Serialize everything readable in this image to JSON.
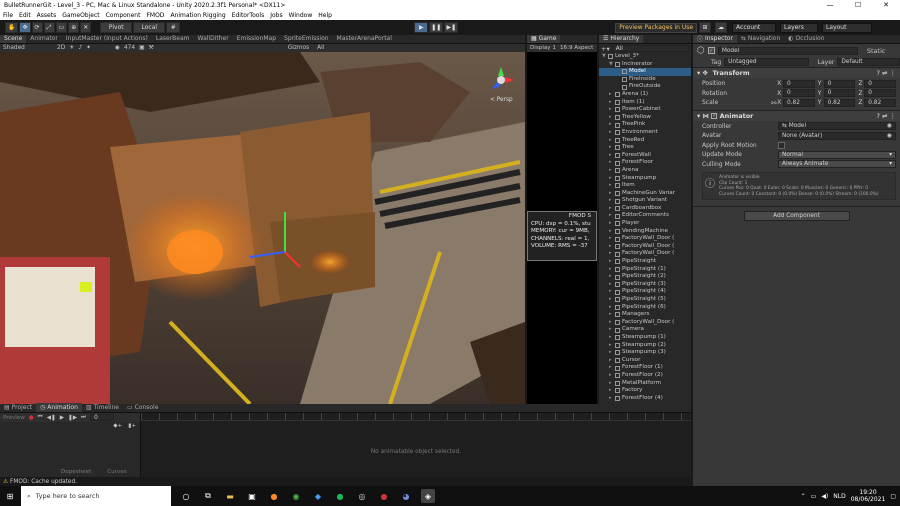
{
  "window": {
    "title": "BulletRunnerGit - Level_3 - PC, Mac & Linux Standalone - Unity 2020.2.3f1 Personal* <DX11>",
    "controls": [
      "—",
      "☐",
      "✕"
    ]
  },
  "menu": [
    "File",
    "Edit",
    "Assets",
    "GameObject",
    "Component",
    "FMOD",
    "Animation Rigging",
    "EditorTools",
    "Jobs",
    "Window",
    "Help"
  ],
  "toolbar": {
    "pivot": "Pivot",
    "local": "Local",
    "preview_packages": "Preview Packages in Use",
    "account": "Account",
    "layers": "Layers",
    "layout": "Layout"
  },
  "scene_tabs": [
    "Scene",
    "Animator",
    "InputMaster (Input Actions)",
    "LaserBeam",
    "WallDither",
    "EmissionMap",
    "SpriteEmission",
    "MasterArenaPortal"
  ],
  "scene_bar": {
    "shading": "Shaded",
    "mode2d": "2D",
    "count": "474",
    "gizmos": "Gizmos",
    "search": "All",
    "persp": "< Persp"
  },
  "game": {
    "tab": "Game",
    "display": "Display 1",
    "aspect": "16:9 Aspect",
    "fmod_title": "FMOD S",
    "fmod_lines": [
      "CPU: dsp = 0.1%, stu",
      "MEMORY: cur = 9MB,",
      "CHANNELS: real = 1,",
      "VOLUME: RMS = -37"
    ]
  },
  "hierarchy": {
    "tab": "Hierarchy",
    "search": "All",
    "items": [
      {
        "name": "Level_3*",
        "indent": 0,
        "arrow": "▼",
        "sel": false
      },
      {
        "name": "Incinerator",
        "indent": 1,
        "arrow": "▼",
        "sel": false
      },
      {
        "name": "Model",
        "indent": 2,
        "arrow": "",
        "sel": true
      },
      {
        "name": "FireInside",
        "indent": 2,
        "arrow": "",
        "sel": false
      },
      {
        "name": "FireOutside",
        "indent": 2,
        "arrow": "",
        "sel": false
      },
      {
        "name": "Arena (1)",
        "indent": 1,
        "arrow": "▸",
        "sel": false
      },
      {
        "name": "Item (1)",
        "indent": 1,
        "arrow": "▸",
        "sel": false
      },
      {
        "name": "PowerCabinet",
        "indent": 1,
        "arrow": "▸",
        "sel": false
      },
      {
        "name": "TreeYellow",
        "indent": 1,
        "arrow": "▸",
        "sel": false
      },
      {
        "name": "TreePink",
        "indent": 1,
        "arrow": "▸",
        "sel": false
      },
      {
        "name": "Environment",
        "indent": 1,
        "arrow": "▸",
        "sel": false
      },
      {
        "name": "TreeRed",
        "indent": 1,
        "arrow": "▸",
        "sel": false
      },
      {
        "name": "Tree",
        "indent": 1,
        "arrow": "▸",
        "sel": false
      },
      {
        "name": "ForestWall",
        "indent": 1,
        "arrow": "▸",
        "sel": false
      },
      {
        "name": "ForestFloor",
        "indent": 1,
        "arrow": "▸",
        "sel": false
      },
      {
        "name": "Arena",
        "indent": 1,
        "arrow": "▸",
        "sel": false
      },
      {
        "name": "Steampump",
        "indent": 1,
        "arrow": "▸",
        "sel": false
      },
      {
        "name": "Item",
        "indent": 1,
        "arrow": "▸",
        "sel": false
      },
      {
        "name": "MachineGun Variar",
        "indent": 1,
        "arrow": "▸",
        "sel": false
      },
      {
        "name": "Shotgun Variant",
        "indent": 1,
        "arrow": "▸",
        "sel": false
      },
      {
        "name": "Cardboardbox",
        "indent": 1,
        "arrow": "▸",
        "sel": false
      },
      {
        "name": "EditorComments",
        "indent": 1,
        "arrow": "▸",
        "sel": false
      },
      {
        "name": "Player",
        "indent": 1,
        "arrow": "▸",
        "sel": false
      },
      {
        "name": "VendingMachine",
        "indent": 1,
        "arrow": "▸",
        "sel": false
      },
      {
        "name": "FactoryWall_Door (",
        "indent": 1,
        "arrow": "▸",
        "sel": false
      },
      {
        "name": "FactoryWall_Door (",
        "indent": 1,
        "arrow": "▸",
        "sel": false
      },
      {
        "name": "FactoryWall_Door (",
        "indent": 1,
        "arrow": "▸",
        "sel": false
      },
      {
        "name": "PipeStraight",
        "indent": 1,
        "arrow": "▸",
        "sel": false
      },
      {
        "name": "PipeStraight (1)",
        "indent": 1,
        "arrow": "▸",
        "sel": false
      },
      {
        "name": "PipeStraight (2)",
        "indent": 1,
        "arrow": "▸",
        "sel": false
      },
      {
        "name": "PipeStraight (3)",
        "indent": 1,
        "arrow": "▸",
        "sel": false
      },
      {
        "name": "PipeStraight (4)",
        "indent": 1,
        "arrow": "▸",
        "sel": false
      },
      {
        "name": "PipeStraight (5)",
        "indent": 1,
        "arrow": "▸",
        "sel": false
      },
      {
        "name": "PipeStraight (6)",
        "indent": 1,
        "arrow": "▸",
        "sel": false
      },
      {
        "name": "Managers",
        "indent": 1,
        "arrow": "▸",
        "sel": false
      },
      {
        "name": "FactoryWall_Door (",
        "indent": 1,
        "arrow": "▸",
        "sel": false
      },
      {
        "name": "Camera",
        "indent": 1,
        "arrow": "▸",
        "sel": false
      },
      {
        "name": "Steampump (1)",
        "indent": 1,
        "arrow": "▸",
        "sel": false
      },
      {
        "name": "Steampump (2)",
        "indent": 1,
        "arrow": "▸",
        "sel": false
      },
      {
        "name": "Steampump (3)",
        "indent": 1,
        "arrow": "▸",
        "sel": false
      },
      {
        "name": "Cursor",
        "indent": 1,
        "arrow": "▸",
        "sel": false
      },
      {
        "name": "ForestFloor (1)",
        "indent": 1,
        "arrow": "▸",
        "sel": false
      },
      {
        "name": "ForestFloor (2)",
        "indent": 1,
        "arrow": "▸",
        "sel": false
      },
      {
        "name": "MetalPlatform",
        "indent": 1,
        "arrow": "▸",
        "sel": false
      },
      {
        "name": "Factory",
        "indent": 1,
        "arrow": "▸",
        "sel": false
      },
      {
        "name": "ForestFloor (4)",
        "indent": 1,
        "arrow": "▸",
        "sel": false
      }
    ]
  },
  "inspector": {
    "tabs": [
      "Inspector",
      "Navigation",
      "Occlusion"
    ],
    "object_name": "Model",
    "static_label": "Static",
    "tag_label": "Tag",
    "tag_value": "Untagged",
    "layer_label": "Layer",
    "layer_value": "Default",
    "transform": {
      "title": "Transform",
      "position_label": "Position",
      "rotation_label": "Rotation",
      "scale_label": "Scale",
      "position": {
        "x": "0",
        "y": "0",
        "z": "0"
      },
      "rotation": {
        "x": "0",
        "y": "0",
        "z": "0"
      },
      "scale": {
        "x": "0.82",
        "y": "0.82",
        "z": "0.82"
      }
    },
    "animator": {
      "title": "Animator",
      "controller_label": "Controller",
      "controller_value": "Model",
      "avatar_label": "Avatar",
      "avatar_value": "None (Avatar)",
      "apply_root_label": "Apply Root Motion",
      "update_mode_label": "Update Mode",
      "update_mode_value": "Normal",
      "culling_label": "Culling Mode",
      "culling_value": "Always Animate",
      "info_lines": [
        "Animator is visible",
        "Clip Count: 1",
        "Curves Pos: 0 Quat: 0 Euler: 0 Scale: 0 Muscles: 0 Generic: 0 PPtr: 0",
        "Curves Count: 0 Constant: 0 (0.0%) Dense: 0 (0.0%) Stream: 0 (100.0%)"
      ]
    },
    "add_component": "Add Component"
  },
  "bottom": {
    "tabs": [
      "Project",
      "Animation",
      "Timeline",
      "Console"
    ],
    "preview": "Preview",
    "frame": "0",
    "empty_msg": "No animatable object selected.",
    "dopesheet": "Dopesheet",
    "curves": "Curves"
  },
  "status": {
    "text": "FMOD: Cache updated."
  },
  "taskbar": {
    "search_placeholder": "Type here to search",
    "lang": "NLD",
    "time": "19:20",
    "date": "08/06/2021"
  }
}
